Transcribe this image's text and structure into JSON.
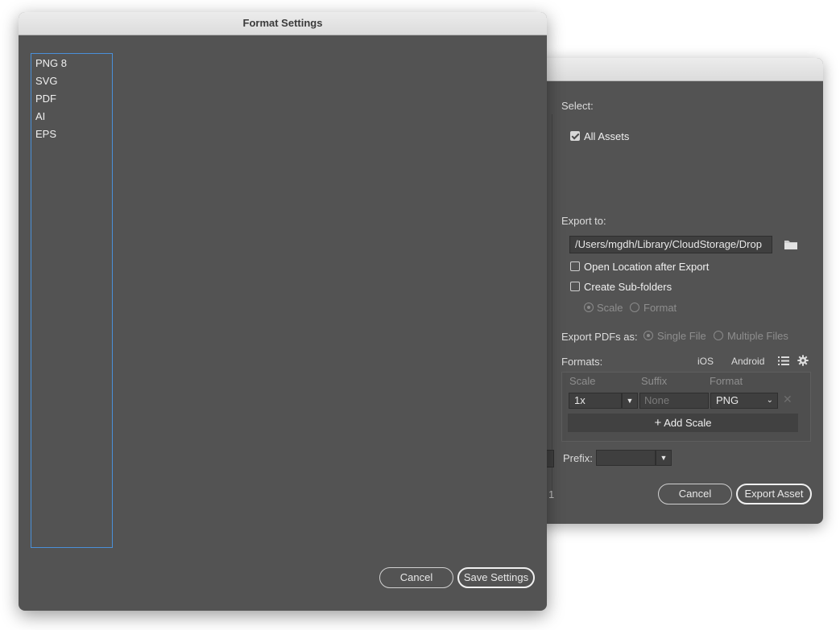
{
  "export_dialog": {
    "select_label": "Select:",
    "all_assets_label": "All Assets",
    "all_assets_checked": true,
    "export_to_label": "Export to:",
    "export_path": "/Users/mgdh/Library/CloudStorage/Drop",
    "open_location_label": "Open Location after Export",
    "create_subfolders_label": "Create Sub-folders",
    "subfolder_scale_label": "Scale",
    "subfolder_format_label": "Format",
    "export_pdfs_label": "Export PDFs as:",
    "single_file_label": "Single File",
    "multiple_files_label": "Multiple Files",
    "formats_label": "Formats:",
    "ios_label": "iOS",
    "android_label": "Android",
    "table": {
      "headers": [
        "Scale",
        "Suffix",
        "Format"
      ],
      "row": {
        "scale": "1x",
        "suffix_placeholder": "None",
        "format": "PNG"
      }
    },
    "add_scale_label": "Add Scale",
    "prefix_label": "Prefix:",
    "partial_count": "1",
    "cancel_label": "Cancel",
    "export_label": "Export Asset"
  },
  "format_settings": {
    "title": "Format Settings",
    "formats": [
      "PNG 8",
      "SVG",
      "PDF",
      "AI",
      "EPS"
    ],
    "cancel_label": "Cancel",
    "save_label": "Save Settings"
  },
  "colors": {
    "panel_bg": "#535353",
    "selection_border": "#4a90d9",
    "titlebar": "#e4e4e4"
  }
}
